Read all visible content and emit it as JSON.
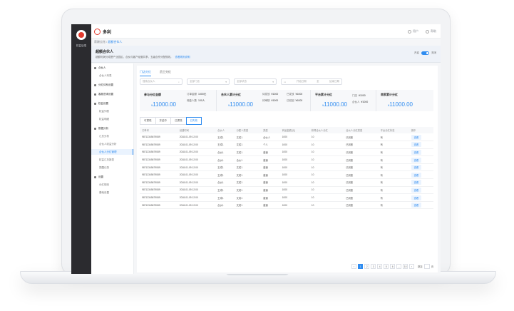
{
  "app": {
    "brand": "多利",
    "dark_caption": "权益后端",
    "top_user": "用户",
    "top_help": "帮助"
  },
  "breadcrumb": {
    "root": "薪酬云账",
    "sep": " / ",
    "current": "超额合伙人"
  },
  "banner": {
    "title": "超额合伙人",
    "desc": "超额利润分成是产业园区，合伙与客户经营共享，五级合作分配规则。",
    "link": "查看规则说明",
    "toggle_left": "开启",
    "toggle_right": "关闭"
  },
  "nav": [
    {
      "label": "合伙人",
      "type": "grp"
    },
    {
      "label": "合伙人列表",
      "type": "sub"
    },
    {
      "label": "分红体系设置",
      "type": "grp"
    },
    {
      "label": "客服咨询设置",
      "type": "grp"
    },
    {
      "label": "权益设置",
      "type": "grp"
    },
    {
      "label": "权益列表",
      "type": "sub"
    },
    {
      "label": "权益明细",
      "type": "sub"
    },
    {
      "label": "数据分析",
      "type": "grp"
    },
    {
      "label": "汇总分析",
      "type": "sub"
    },
    {
      "label": "合伙人收益分析",
      "type": "sub"
    },
    {
      "label": "合伙人分红管理",
      "type": "sub",
      "active": true
    },
    {
      "label": "权益汇总报表",
      "type": "sub"
    },
    {
      "label": "提醒记录",
      "type": "sub"
    },
    {
      "label": "设置",
      "type": "grp"
    },
    {
      "label": "分红规则",
      "type": "sub"
    },
    {
      "label": "基础设置",
      "type": "sub"
    }
  ],
  "tabs": [
    "门店分红",
    "员工分红"
  ],
  "filters": {
    "search_placeholder": "搜索合伙人",
    "select1": "全部门店",
    "select2": "全部状态",
    "date_start": "开始日期",
    "date_sep": "至",
    "date_end": "结束日期"
  },
  "stats": {
    "card1": {
      "title": "参与分红金额",
      "value": "11000.00",
      "k1": "订单金额",
      "v1": "1000元",
      "k2": "佣金人数",
      "v2": "100人"
    },
    "card2": {
      "title": "合伙人累计分红",
      "value": "11000.00",
      "k1": "待发放",
      "v1": "¥1000",
      "k2": "已发放",
      "v2": "¥1000",
      "k3": "待审核",
      "v3": "¥1000",
      "k4": "已驳回",
      "v4": "¥1000"
    },
    "card3": {
      "title": "平台累计分红",
      "value": "11000.00",
      "k1": "门店",
      "v1": "¥1000",
      "k2": "合伙人",
      "v2": "¥1000"
    },
    "card4": {
      "title": "商家累计分红",
      "value": "11000.00"
    },
    "currency": "¥"
  },
  "result_tabs": [
    "可提现",
    "冻结中",
    "已提现",
    "已失效"
  ],
  "table": {
    "headers": [
      "订单号",
      "创建时间",
      "合伙人",
      "分配人类型",
      "类型",
      "商品金额(元)",
      "获得合伙人分红",
      "合伙人分红类型",
      "平台分红状态",
      "操作"
    ],
    "rows": [
      [
        "98712345679089",
        "2018-01-09 12:00",
        "王成1",
        "文成1",
        "合伙人",
        "1000",
        "10",
        "已到账",
        "有",
        "查看"
      ],
      [
        "98712345679089",
        "2018-01-09 12:00",
        "王成1",
        "文成1",
        "个人",
        "1000",
        "10",
        "已到账",
        "有",
        "查看"
      ],
      [
        "98712345679089",
        "2018-01-09 12:00",
        "合伙1",
        "文成1",
        "普通",
        "1000",
        "10",
        "已到账",
        "有",
        "查看"
      ],
      [
        "98712345679089",
        "2018-01-09 12:00",
        "合伙1",
        "合伙1",
        "普通",
        "1000",
        "10",
        "已到账",
        "有",
        "查看"
      ],
      [
        "98712345679089",
        "2018-01-09 12:00",
        "王成1",
        "文成1",
        "普通",
        "1000",
        "10",
        "已到账",
        "有",
        "查看"
      ],
      [
        "98712345679089",
        "2018-01-09 12:00",
        "王成1",
        "文成1",
        "普通",
        "1000",
        "10",
        "已到账",
        "有",
        "查看"
      ],
      [
        "98712345679089",
        "2018-01-09 12:00",
        "合伙1",
        "文成1",
        "普通",
        "1000",
        "10",
        "已到账",
        "有",
        "查看"
      ],
      [
        "98712345679089",
        "2018-01-09 12:00",
        "王成1",
        "文成1",
        "普通",
        "1000",
        "10",
        "已到账",
        "有",
        "查看"
      ],
      [
        "98712345679089",
        "2018-01-09 12:00",
        "王成1",
        "文成1",
        "普通",
        "1000",
        "10",
        "已到账",
        "有",
        "查看"
      ],
      [
        "98712345679089",
        "2018-01-09 12:00",
        "合伙1",
        "文成1",
        "普通",
        "1000",
        "10",
        "已到账",
        "有",
        "查看"
      ]
    ]
  },
  "pager": {
    "prev": "‹",
    "pages": [
      "1",
      "2",
      "3",
      "4",
      "5",
      "6",
      "…",
      "10"
    ],
    "next": "›",
    "jump_label": "跳至",
    "jump_unit": "页"
  },
  "colors": {
    "accent": "#2f8cf0",
    "brand": "#e23b2e"
  }
}
